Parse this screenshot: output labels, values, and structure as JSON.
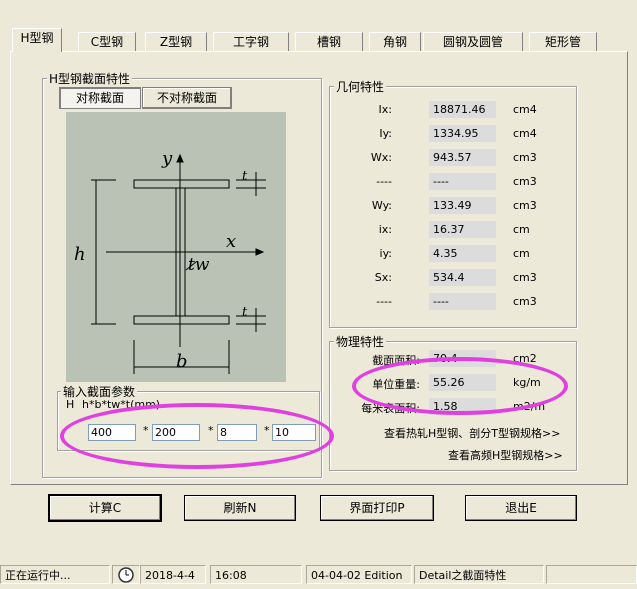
{
  "tabs": [
    "H型钢",
    "C型钢",
    "Z型钢",
    "工字钢",
    "槽钢",
    "角钢",
    "圆钢及圆管",
    "矩形管"
  ],
  "section_group": {
    "title": "H型钢截面特性",
    "symmetric_btn": "对称截面",
    "asymmetric_btn": "不对称截面"
  },
  "diagram": {
    "label_y": "y",
    "label_x": "x",
    "label_h": "h",
    "label_b": "b",
    "label_tw": "tw",
    "label_t": "t"
  },
  "input_group": {
    "title": "输入截面参数",
    "formula_prefix": "H",
    "formula": "h*b*tw*t(mm)",
    "h": "400",
    "b": "200",
    "tw": "8",
    "t": "10",
    "sep": "*"
  },
  "geometry": {
    "title": "几何特性",
    "rows": [
      {
        "label": "Ix:",
        "value": "18871.46",
        "unit": "cm4"
      },
      {
        "label": "Iy:",
        "value": "1334.95",
        "unit": "cm4"
      },
      {
        "label": "Wx:",
        "value": "943.57",
        "unit": "cm3"
      },
      {
        "label": "----",
        "value": "----",
        "unit": "cm3"
      },
      {
        "label": "Wy:",
        "value": "133.49",
        "unit": "cm3"
      },
      {
        "label": "ix:",
        "value": "16.37",
        "unit": "cm"
      },
      {
        "label": "iy:",
        "value": "4.35",
        "unit": "cm"
      },
      {
        "label": "Sx:",
        "value": "534.4",
        "unit": "cm3"
      },
      {
        "label": "----",
        "value": "----",
        "unit": "cm3"
      }
    ]
  },
  "physical": {
    "title": "物理特性",
    "rows": [
      {
        "label": "截面面积:",
        "value": "70.4",
        "unit": "cm2"
      },
      {
        "label": "单位重量:",
        "value": "55.26",
        "unit": "kg/m"
      },
      {
        "label": "每米表面积:",
        "value": "1.58",
        "unit": "m2/m"
      }
    ],
    "link1": "查看热轧H型钢、剖分T型钢规格>>",
    "link2": "查看高频H型钢规格>>"
  },
  "buttons": {
    "calc": "计算C",
    "refresh": "刷新N",
    "print": "界面打印P",
    "exit": "退出E"
  },
  "status": {
    "s1": "正在运行中...",
    "date": "2018-4-4",
    "time": "16:08",
    "edition": "04-04-02 Edition",
    "detail": "Detail之截面特性"
  },
  "colors": {
    "highlight": "#e040e0",
    "diagram_bg": "#b9c2b4"
  }
}
